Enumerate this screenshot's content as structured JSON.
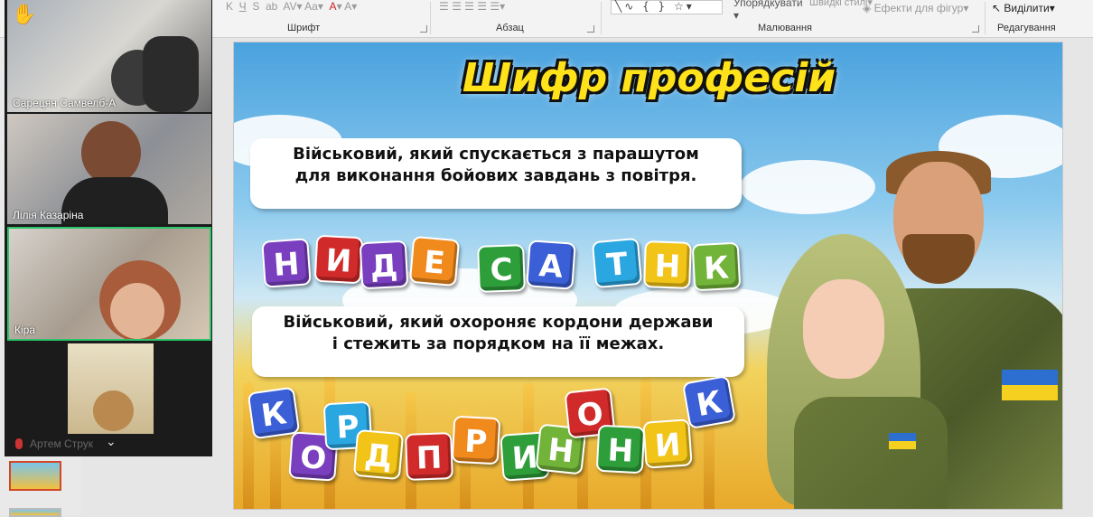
{
  "ribbon": {
    "groups": [
      {
        "label": "Шрифт"
      },
      {
        "label": "Абзац"
      },
      {
        "label": "Малювання"
      },
      {
        "label": "Редагування"
      }
    ],
    "quick_styles": "Швидкі стилі",
    "shape_effects": "Ефекти для фігур",
    "select": "Виділити",
    "arrange_partial": "Упорядкувати"
  },
  "participants": [
    {
      "name": "Сарецян Самвелб-А"
    },
    {
      "name": "Лілія Казаріна"
    },
    {
      "name": "Кіра"
    },
    {
      "name": "Артем Струк"
    }
  ],
  "slide": {
    "title": "Шифр професій",
    "clue1_line1": "Військовий, який спускається з парашутом",
    "clue1_line2": "для виконання бойових завдань з повітря.",
    "clue2_line1": "Військовий, який охороняє кордони держави",
    "clue2_line2": "і стежить за порядком на її межах.",
    "word1_letters": [
      "Н",
      "И",
      "Д",
      "Е",
      "С",
      "А",
      "Т",
      "Н",
      "К"
    ],
    "word2_letters": [
      "К",
      "О",
      "Р",
      "Д",
      "П",
      "Р",
      "И",
      "Н",
      "О",
      "Н",
      "И",
      "К"
    ]
  },
  "colors": {
    "tile_colors_word1": [
      "#7a3fbf",
      "#d12a2a",
      "#7a3fbf",
      "#f08a1c",
      "#2e9e3a",
      "#3b5fd6",
      "#2aa6e0",
      "#f2c417",
      "#72b33a"
    ],
    "tile_colors_word2": [
      "#3b5fd6",
      "#7a3fbf",
      "#2aa6e0",
      "#f2c417",
      "#d12a2a",
      "#f08a1c",
      "#2e9e3a",
      "#72b33a",
      "#d12a2a",
      "#2e9e3a",
      "#f2c417",
      "#3b5fd6"
    ],
    "title_yellow": "#ffe21a",
    "active_speaker_border": "#2bc46a"
  },
  "icons": [
    "raise-hand-icon",
    "chevron-down-icon",
    "muted-mic-icon",
    "select-arrow-icon"
  ]
}
